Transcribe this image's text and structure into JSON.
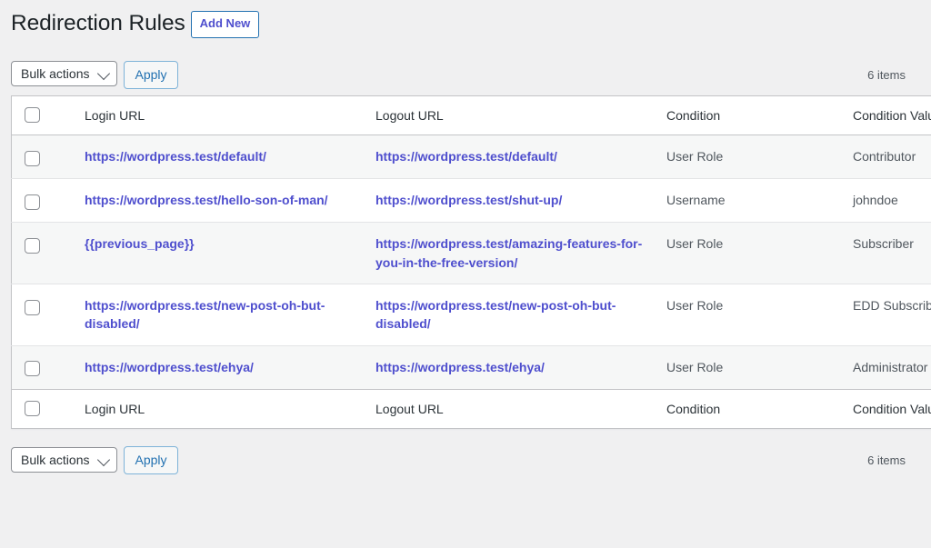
{
  "header": {
    "title": "Redirection Rules",
    "add_new_label": "Add New"
  },
  "toolbar_top": {
    "bulk_actions_label": "Bulk actions",
    "apply_label": "Apply",
    "items_count": "6 items"
  },
  "toolbar_bottom": {
    "bulk_actions_label": "Bulk actions",
    "apply_label": "Apply",
    "items_count": "6 items"
  },
  "table": {
    "columns": [
      {
        "key": "login",
        "label": "Login URL"
      },
      {
        "key": "logout",
        "label": "Logout URL"
      },
      {
        "key": "condition",
        "label": "Condition"
      },
      {
        "key": "condition_value",
        "label": "Condition Value"
      }
    ],
    "rows": [
      {
        "login": "https://wordpress.test/default/",
        "logout": "https://wordpress.test/default/",
        "condition": "User Role",
        "condition_value": "Contributor"
      },
      {
        "login": "https://wordpress.test/hello-son-of-man/",
        "logout": "https://wordpress.test/shut-up/",
        "condition": "Username",
        "condition_value": "johndoe"
      },
      {
        "login": "{{previous_page}}",
        "logout": "https://wordpress.test/amazing-features-for-you-in-the-free-version/",
        "condition": "User Role",
        "condition_value": "Subscriber"
      },
      {
        "login": "https://wordpress.test/new-post-oh-but-disabled/",
        "logout": "https://wordpress.test/new-post-oh-but-disabled/",
        "condition": "User Role",
        "condition_value": "EDD Subscriber"
      },
      {
        "login": "https://wordpress.test/ehya/",
        "logout": "https://wordpress.test/ehya/",
        "condition": "User Role",
        "condition_value": "Administrator"
      }
    ]
  },
  "colors": {
    "page_background": "#f0f0f1",
    "link": "#4f4fce",
    "accent_blue": "#2271b1",
    "row_alt_background": "#f6f7f7",
    "table_border": "#c3c4c7",
    "text": "#50575e",
    "heading_text": "#1d2327"
  }
}
